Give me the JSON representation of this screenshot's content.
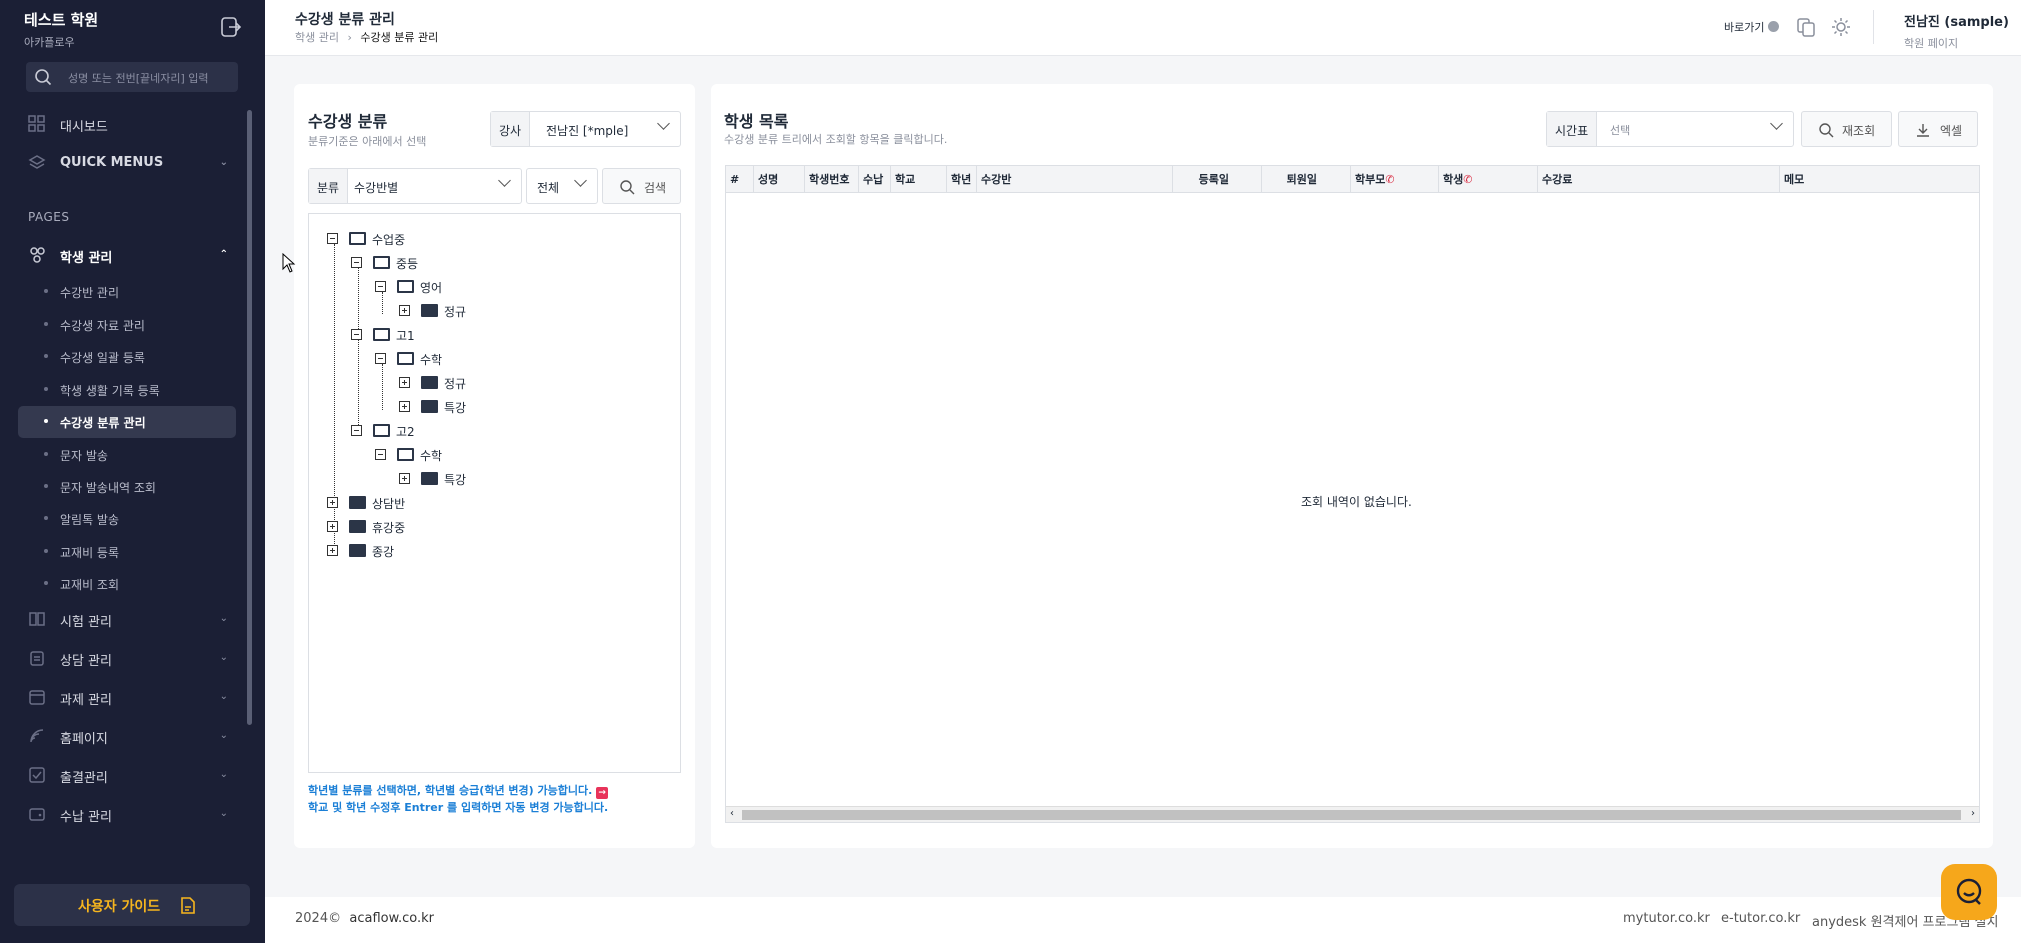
{
  "brand": {
    "name": "테스트 학원",
    "sub": "아카플로우"
  },
  "search": {
    "placeholder": "성명 또는 전번[끝네자리] 입력"
  },
  "nav": {
    "dashboard": "대시보드",
    "quick": "QUICK MENUS",
    "pages": "PAGES",
    "student": "학생 관리",
    "subs": [
      "수강반 관리",
      "수강생 자료 관리",
      "수강생 일괄 등록",
      "학생 생활 기록 등록",
      "수강생 분류 관리",
      "문자 발송",
      "문자 발송내역 조회",
      "알림톡 발송",
      "교재비 등록",
      "교재비 조회"
    ],
    "exam": "시험 관리",
    "consult": "상담 관리",
    "homework": "과제 관리",
    "homepage": "홈페이지",
    "attendance": "출결관리",
    "payment": "수납 관리"
  },
  "guide": "사용자 가이드",
  "header": {
    "title": "수강생 분류 관리",
    "crumb1": "학생 관리",
    "crumb_sep": "›",
    "crumb2": "수강생 분류 관리",
    "shortcut": "바로가기",
    "user_name": "전남진 (sample)",
    "user_sub": "학원 페이지"
  },
  "left": {
    "title": "수강생 분류",
    "subtitle": "분류기준은 아래에서 선택",
    "teacher_label": "강사",
    "teacher_value": "전남진 [*mple]",
    "cat_label": "분류",
    "cat_value": "수강반별",
    "all_value": "전체",
    "search_btn": "검색",
    "tree": [
      "수업중",
      "중등",
      "영어",
      "정규",
      "고1",
      "수학",
      "정규",
      "특강",
      "고2",
      "수학",
      "특강",
      "상담반",
      "휴강중",
      "종강"
    ],
    "note1": "학년별 분류를 선택하면, 학년별 승급(학년 변경) 가능합니다.",
    "note2": "학교 및 학년 수정후 Entrer 를 입력하면 자동 변경 가능합니다."
  },
  "right": {
    "title": "학생 목록",
    "subtitle": "수강생 분류 트리에서 조회할 항목을 클릭합니다.",
    "tt_label": "시간표",
    "tt_placeholder": "선택",
    "reload_btn": "재조회",
    "excel_btn": "엑셀",
    "columns": [
      "#",
      "성명",
      "학생번호",
      "수납",
      "학교",
      "학년",
      "수강반",
      "등록일",
      "퇴원일",
      "학부모",
      "학생",
      "수강료",
      "메모"
    ],
    "empty": "조회 내역이 없습니다."
  },
  "footer": {
    "copy": "2024©",
    "site": "acaflow.co.kr",
    "link1": "mytutor.co.kr",
    "link2": "e-tutor.co.kr",
    "link3": "anydesk 원격제어 프로그램 설치"
  },
  "colors": {
    "sidebar": "#1b1f35",
    "accent": "#f6a71b",
    "link": "#1b7fd6"
  }
}
